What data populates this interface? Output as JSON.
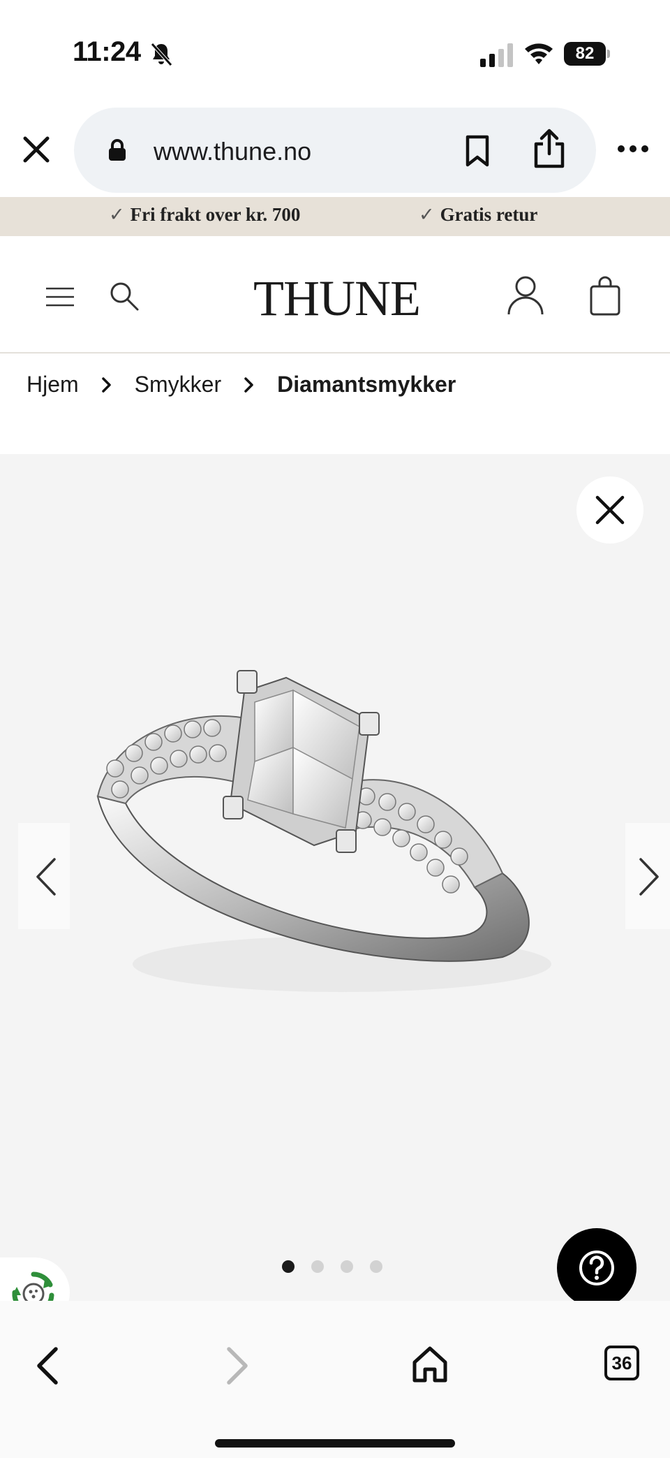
{
  "status_bar": {
    "time": "11:24",
    "battery": "82"
  },
  "browser": {
    "url": "www.thune.no"
  },
  "promo": {
    "item1": "Fri frakt over kr. 700",
    "item2": "Gratis retur",
    "check": "✓"
  },
  "header": {
    "logo": "THUNE"
  },
  "breadcrumb": {
    "home": "Hjem",
    "category": "Smykker",
    "current": "Diamantsmykker"
  },
  "gallery": {
    "image_count": 4,
    "active_index": 0
  },
  "toolbar": {
    "tab_count": "36"
  },
  "colors": {
    "promo_bg": "#e7e1d8",
    "eco_green": "#2f8f3a"
  }
}
